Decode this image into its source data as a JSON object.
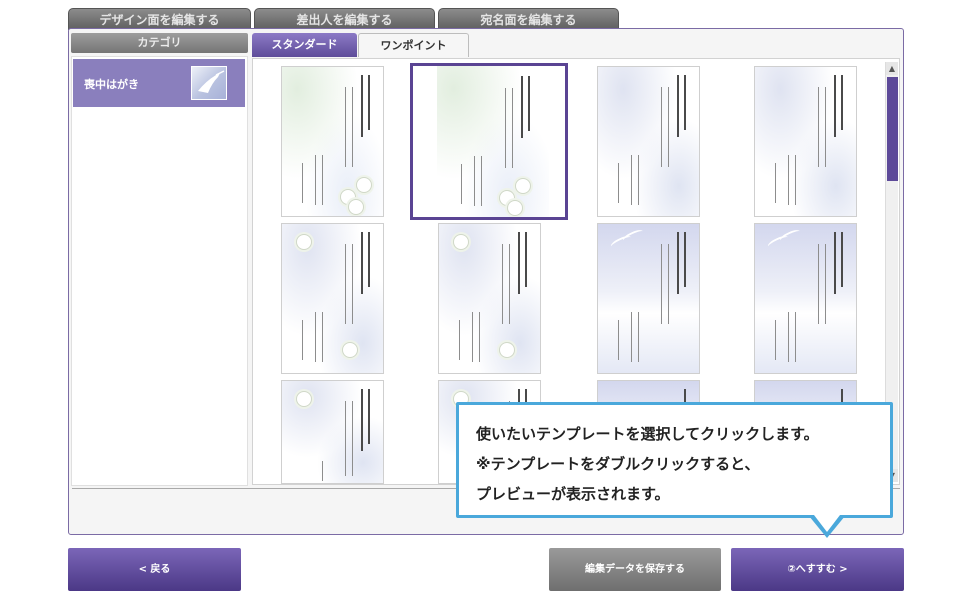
{
  "top_tabs": [
    {
      "label": "デザイン面を編集する"
    },
    {
      "label": "差出人を編集する"
    },
    {
      "label": "宛名面を編集する"
    }
  ],
  "category": {
    "header": "カテゴリ",
    "items": [
      {
        "label": "喪中はがき"
      }
    ]
  },
  "sub_tabs": [
    {
      "label": "スタンダード"
    },
    {
      "label": "ワンポイント"
    }
  ],
  "tooltip": {
    "line1": "使いたいテンプレートを選択してクリックします。",
    "line2": "※テンプレートをダブルクリックすると、",
    "line3": "プレビューが表示されます。"
  },
  "buttons": {
    "back": "< 戻る",
    "save": "編集データを保存する",
    "next": "②へすすむ >"
  },
  "colors": {
    "accent": "#5e4c99",
    "tooltip_border": "#4aa8db",
    "category_selected": "#8a7fbd"
  }
}
